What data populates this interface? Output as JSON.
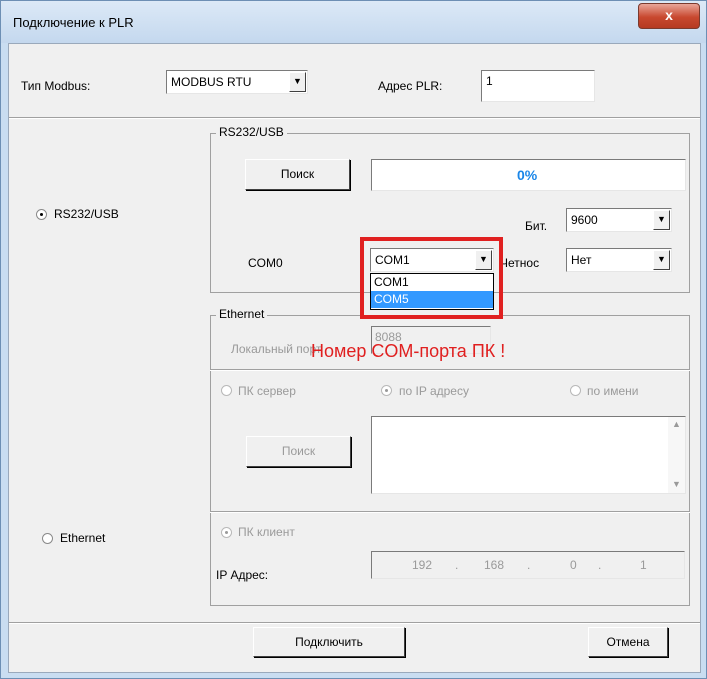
{
  "window": {
    "title": "Подключение к PLR",
    "close_label": "x"
  },
  "top": {
    "modbus_type_label": "Тип Modbus:",
    "modbus_type_value": "MODBUS RTU",
    "plr_address_label": "Адрес PLR:",
    "plr_address_value": "1"
  },
  "mode": {
    "rs_label": "RS232/USB",
    "eth_label": "Ethernet",
    "selected": "RS232/USB"
  },
  "rs232": {
    "group_title": "RS232/USB",
    "search_label": "Поиск",
    "progress_text": "0%",
    "progress_value": 0,
    "baud_label": "Бит.",
    "baud_value": "9600",
    "com_label": "COM0",
    "com_value": "COM1",
    "com_options": [
      "COM1",
      "COM5"
    ],
    "com_highlighted": "COM5",
    "parity_label": "Четнос",
    "parity_value": "Нет"
  },
  "ethernet": {
    "group_title": "Ethernet",
    "local_port_label": "Локальный порт",
    "local_port_value": "8088",
    "pc_server_label": "ПК сервер",
    "by_ip_label": "по IP адресу",
    "by_name_label": "по имени",
    "search_label": "Поиск",
    "pc_client_label": "ПК клиент",
    "ip_label": "IP Адрес:",
    "ip_octets": [
      "192",
      "168",
      "0",
      "1"
    ]
  },
  "annotation": {
    "text": "Номер COM-порта ПК !",
    "color": "#e02020"
  },
  "footer": {
    "connect_label": "Подключить",
    "cancel_label": "Отмена"
  },
  "colors": {
    "progress_text": "#1a86e8",
    "highlight": "#3399ff",
    "annotation_box": "#e02020"
  }
}
